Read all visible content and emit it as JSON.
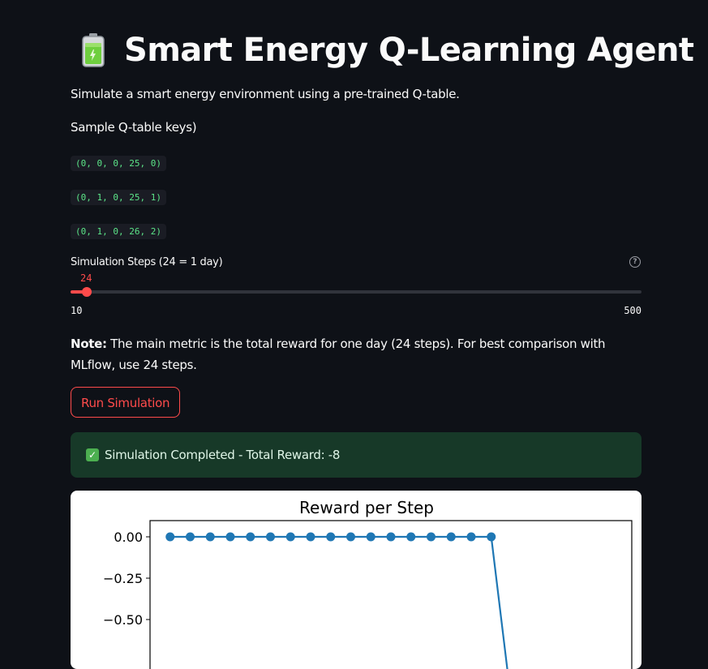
{
  "header": {
    "icon": "battery-icon",
    "title": "Smart Energy Q-Learning Agent"
  },
  "intro": "Simulate a smart energy environment using a pre-trained Q-table.",
  "qtable": {
    "label": "Sample Q-table keys)",
    "keys": [
      "(0, 0, 0, 25, 0)",
      "(0, 1, 0, 25, 1)",
      "(0, 1, 0, 26, 2)"
    ]
  },
  "slider": {
    "label": "Simulation Steps (24 = 1 day)",
    "value": "24",
    "min": "10",
    "max": "500",
    "help_icon": "question-circle-icon",
    "accent": "#ff4b4b"
  },
  "note": {
    "bold": "Note:",
    "text": " The main metric is the total reward for one day (24 steps). For best comparison with MLflow, use 24 steps."
  },
  "run_button": "Run Simulation",
  "alert": {
    "icon": "check-box-icon",
    "text": "Simulation Completed - Total Reward: -8",
    "color": "#173928"
  },
  "chart_data": {
    "type": "line",
    "title": "Reward per Step",
    "series_color": "#1f77b4",
    "x": [
      0,
      1,
      2,
      3,
      4,
      5,
      6,
      7,
      8,
      9,
      10,
      11,
      12,
      13,
      14,
      15,
      16,
      17
    ],
    "values": [
      0,
      0,
      0,
      0,
      0,
      0,
      0,
      0,
      0,
      0,
      0,
      0,
      0,
      0,
      0,
      0,
      0,
      -1
    ],
    "yticks": [
      "0.00",
      "−0.25",
      "−0.50"
    ],
    "ylim_visible": [
      -0.7,
      0.1
    ],
    "xlim": [
      -1.0,
      23.0
    ]
  }
}
